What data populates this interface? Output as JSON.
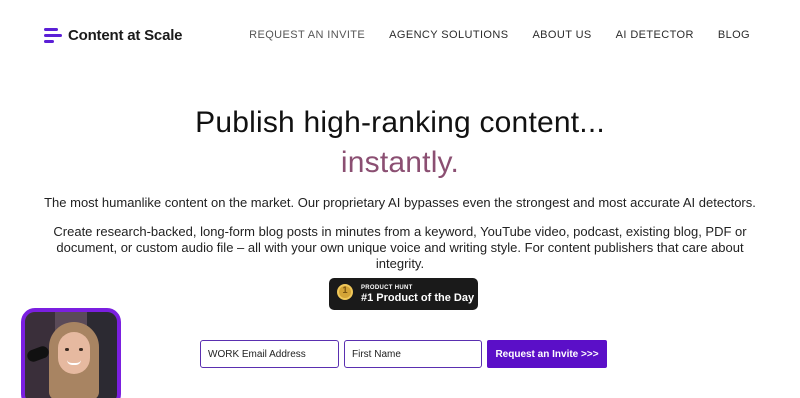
{
  "brand": {
    "name": "Content at Scale",
    "accent_color": "#5b1fd6"
  },
  "nav": {
    "items": [
      {
        "label": "REQUEST AN INVITE"
      },
      {
        "label": "AGENCY SOLUTIONS"
      },
      {
        "label": "ABOUT US"
      },
      {
        "label": "AI DETECTOR"
      },
      {
        "label": "BLOG"
      }
    ]
  },
  "hero": {
    "headline": "Publish high-ranking content...",
    "accent": "instantly.",
    "accent_color": "#8b4f72",
    "subtitle": "The most humanlike content on the market. Our proprietary AI bypasses even the strongest and most accurate AI detectors.",
    "description": "Create research-backed, long-form blog posts in minutes from a keyword, YouTube video, podcast, existing blog, PDF or document, or custom audio file – all with your own unique voice and writing style. For content publishers that care about integrity."
  },
  "badge": {
    "small": "PRODUCT HUNT",
    "big": "#1 Product of the Day",
    "medal_number": "1",
    "icon": "medal-icon"
  },
  "form": {
    "email_placeholder": "WORK Email Address",
    "first_name_placeholder": "First Name",
    "submit_label": "Request an Invite >>>",
    "button_color": "#5b0fc8"
  },
  "video_widget": {
    "icon": "presenter-video"
  }
}
